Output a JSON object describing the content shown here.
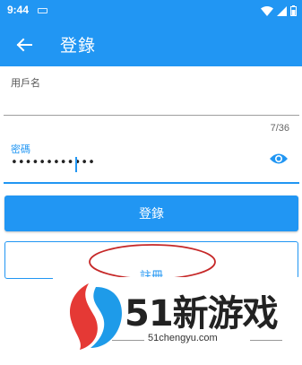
{
  "colors": {
    "primary": "#2196F3",
    "accent_red": "#C62828",
    "logo_blue": "#1E9BE9",
    "logo_red": "#E53935"
  },
  "status_bar": {
    "time": "9:44",
    "icons": [
      "sim-card-icon",
      "wifi-icon",
      "signal-icon",
      "battery-icon"
    ]
  },
  "app_bar": {
    "back_icon": "arrow-left-icon",
    "title": "登錄"
  },
  "form": {
    "username": {
      "label": "用戶名",
      "value": "",
      "counter": "7/36"
    },
    "password": {
      "label": "密碼",
      "value": "••••••••••••",
      "toggle_icon": "eye-icon"
    }
  },
  "buttons": {
    "login": "登錄",
    "secondary": "註冊"
  },
  "watermark": {
    "logo_icon": "51-logo-icon",
    "brand": "51新游戏",
    "url": "51chengyu.com"
  }
}
